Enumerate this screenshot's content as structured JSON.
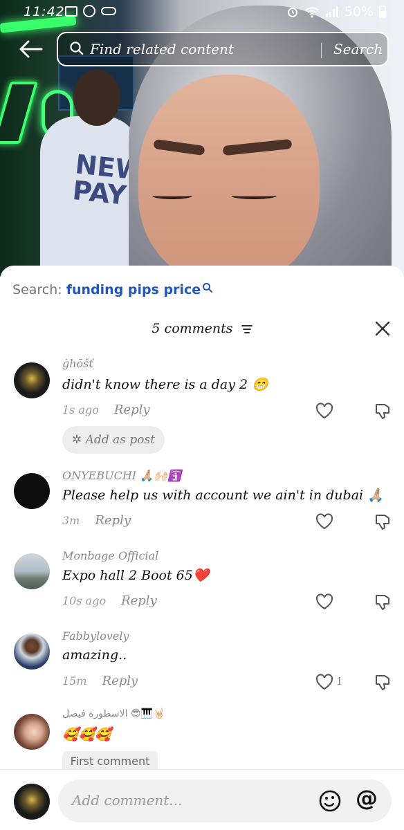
{
  "status_bar": {
    "time": "11:42",
    "battery": "50%"
  },
  "search": {
    "placeholder": "Find related content",
    "button_label": "Search"
  },
  "sheet": {
    "search_prefix": "Search:",
    "search_query": "funding pips price",
    "comments_title": "5 comments"
  },
  "comments": [
    {
      "username": "ġhōšť",
      "text": "didn't know there is a day 2 😁",
      "time": "1s ago",
      "reply": "Reply",
      "add_as_post": "Add as post",
      "likes": ""
    },
    {
      "username": "ONYEBUCHI 🙏🏼🙌🏻🛐",
      "text": "Please help us with account we ain't in dubai 🙏🏼",
      "time": "3m",
      "reply": "Reply",
      "likes": ""
    },
    {
      "username": "Monbage Official",
      "text": "Expo hall 2 Boot 65❤️",
      "time": "10s ago",
      "reply": "Reply",
      "likes": ""
    },
    {
      "username": "Fabbylovely",
      "text": "amazing..",
      "time": "15m",
      "reply": "Reply",
      "likes": "1"
    },
    {
      "username": "الاسطورة فيصل 😎🎹🤘🏻",
      "text": "🥰🥰🥰",
      "badge": "First comment"
    }
  ],
  "input": {
    "placeholder": "Add comment..."
  },
  "colors": {
    "link_blue": "#2456b9",
    "pill_bg": "#f1f1f1"
  }
}
